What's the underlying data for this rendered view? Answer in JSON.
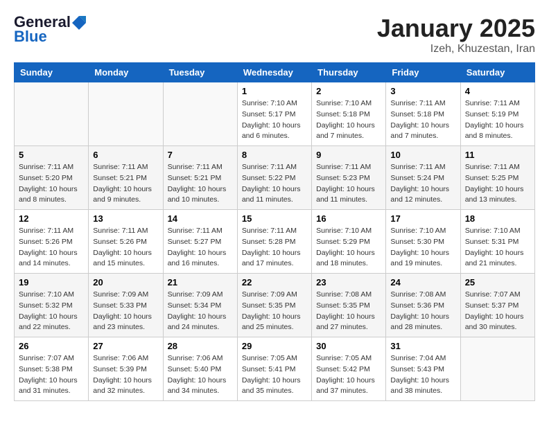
{
  "header": {
    "logo_line1": "General",
    "logo_line2": "Blue",
    "title": "January 2025",
    "subtitle": "Izeh, Khuzestan, Iran"
  },
  "weekdays": [
    "Sunday",
    "Monday",
    "Tuesday",
    "Wednesday",
    "Thursday",
    "Friday",
    "Saturday"
  ],
  "weeks": [
    [
      {
        "day": "",
        "info": ""
      },
      {
        "day": "",
        "info": ""
      },
      {
        "day": "",
        "info": ""
      },
      {
        "day": "1",
        "info": "Sunrise: 7:10 AM\nSunset: 5:17 PM\nDaylight: 10 hours\nand 6 minutes."
      },
      {
        "day": "2",
        "info": "Sunrise: 7:10 AM\nSunset: 5:18 PM\nDaylight: 10 hours\nand 7 minutes."
      },
      {
        "day": "3",
        "info": "Sunrise: 7:11 AM\nSunset: 5:18 PM\nDaylight: 10 hours\nand 7 minutes."
      },
      {
        "day": "4",
        "info": "Sunrise: 7:11 AM\nSunset: 5:19 PM\nDaylight: 10 hours\nand 8 minutes."
      }
    ],
    [
      {
        "day": "5",
        "info": "Sunrise: 7:11 AM\nSunset: 5:20 PM\nDaylight: 10 hours\nand 8 minutes."
      },
      {
        "day": "6",
        "info": "Sunrise: 7:11 AM\nSunset: 5:21 PM\nDaylight: 10 hours\nand 9 minutes."
      },
      {
        "day": "7",
        "info": "Sunrise: 7:11 AM\nSunset: 5:21 PM\nDaylight: 10 hours\nand 10 minutes."
      },
      {
        "day": "8",
        "info": "Sunrise: 7:11 AM\nSunset: 5:22 PM\nDaylight: 10 hours\nand 11 minutes."
      },
      {
        "day": "9",
        "info": "Sunrise: 7:11 AM\nSunset: 5:23 PM\nDaylight: 10 hours\nand 11 minutes."
      },
      {
        "day": "10",
        "info": "Sunrise: 7:11 AM\nSunset: 5:24 PM\nDaylight: 10 hours\nand 12 minutes."
      },
      {
        "day": "11",
        "info": "Sunrise: 7:11 AM\nSunset: 5:25 PM\nDaylight: 10 hours\nand 13 minutes."
      }
    ],
    [
      {
        "day": "12",
        "info": "Sunrise: 7:11 AM\nSunset: 5:26 PM\nDaylight: 10 hours\nand 14 minutes."
      },
      {
        "day": "13",
        "info": "Sunrise: 7:11 AM\nSunset: 5:26 PM\nDaylight: 10 hours\nand 15 minutes."
      },
      {
        "day": "14",
        "info": "Sunrise: 7:11 AM\nSunset: 5:27 PM\nDaylight: 10 hours\nand 16 minutes."
      },
      {
        "day": "15",
        "info": "Sunrise: 7:11 AM\nSunset: 5:28 PM\nDaylight: 10 hours\nand 17 minutes."
      },
      {
        "day": "16",
        "info": "Sunrise: 7:10 AM\nSunset: 5:29 PM\nDaylight: 10 hours\nand 18 minutes."
      },
      {
        "day": "17",
        "info": "Sunrise: 7:10 AM\nSunset: 5:30 PM\nDaylight: 10 hours\nand 19 minutes."
      },
      {
        "day": "18",
        "info": "Sunrise: 7:10 AM\nSunset: 5:31 PM\nDaylight: 10 hours\nand 21 minutes."
      }
    ],
    [
      {
        "day": "19",
        "info": "Sunrise: 7:10 AM\nSunset: 5:32 PM\nDaylight: 10 hours\nand 22 minutes."
      },
      {
        "day": "20",
        "info": "Sunrise: 7:09 AM\nSunset: 5:33 PM\nDaylight: 10 hours\nand 23 minutes."
      },
      {
        "day": "21",
        "info": "Sunrise: 7:09 AM\nSunset: 5:34 PM\nDaylight: 10 hours\nand 24 minutes."
      },
      {
        "day": "22",
        "info": "Sunrise: 7:09 AM\nSunset: 5:35 PM\nDaylight: 10 hours\nand 25 minutes."
      },
      {
        "day": "23",
        "info": "Sunrise: 7:08 AM\nSunset: 5:35 PM\nDaylight: 10 hours\nand 27 minutes."
      },
      {
        "day": "24",
        "info": "Sunrise: 7:08 AM\nSunset: 5:36 PM\nDaylight: 10 hours\nand 28 minutes."
      },
      {
        "day": "25",
        "info": "Sunrise: 7:07 AM\nSunset: 5:37 PM\nDaylight: 10 hours\nand 30 minutes."
      }
    ],
    [
      {
        "day": "26",
        "info": "Sunrise: 7:07 AM\nSunset: 5:38 PM\nDaylight: 10 hours\nand 31 minutes."
      },
      {
        "day": "27",
        "info": "Sunrise: 7:06 AM\nSunset: 5:39 PM\nDaylight: 10 hours\nand 32 minutes."
      },
      {
        "day": "28",
        "info": "Sunrise: 7:06 AM\nSunset: 5:40 PM\nDaylight: 10 hours\nand 34 minutes."
      },
      {
        "day": "29",
        "info": "Sunrise: 7:05 AM\nSunset: 5:41 PM\nDaylight: 10 hours\nand 35 minutes."
      },
      {
        "day": "30",
        "info": "Sunrise: 7:05 AM\nSunset: 5:42 PM\nDaylight: 10 hours\nand 37 minutes."
      },
      {
        "day": "31",
        "info": "Sunrise: 7:04 AM\nSunset: 5:43 PM\nDaylight: 10 hours\nand 38 minutes."
      },
      {
        "day": "",
        "info": ""
      }
    ]
  ]
}
